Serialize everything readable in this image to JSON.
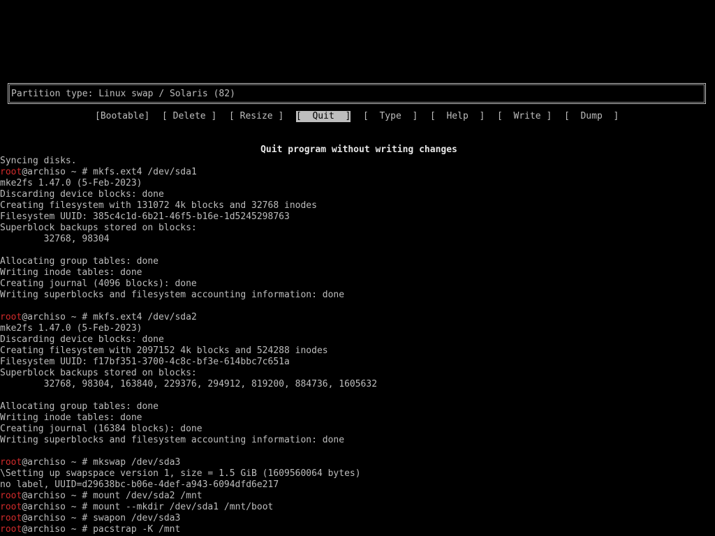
{
  "cfdisk": {
    "partition_type": "Partition type: Linux swap / Solaris (82)",
    "menu": [
      {
        "label": "[Bootable]",
        "selected": false
      },
      {
        "label": "[ Delete ]",
        "selected": false
      },
      {
        "label": "[ Resize ]",
        "selected": false
      },
      {
        "label": "[  Quit  ]",
        "selected": true
      },
      {
        "label": "[  Type  ]",
        "selected": false
      },
      {
        "label": "[  Help  ]",
        "selected": false
      },
      {
        "label": "[  Write ]",
        "selected": false
      },
      {
        "label": "[  Dump  ]",
        "selected": false
      }
    ],
    "hint": "Quit program without writing changes"
  },
  "terminal": {
    "colors": {
      "background": "#000000",
      "foreground": "#bdbdbd",
      "prompt_user": "#d22b2b"
    },
    "lines": [
      {
        "text": "Syncing disks."
      },
      {
        "prompt": {
          "user": "root",
          "host": "@archiso",
          "cmd": " ~ # mkfs.ext4 /dev/sda1"
        }
      },
      {
        "text": "mke2fs 1.47.0 (5-Feb-2023)"
      },
      {
        "text": "Discarding device blocks: done"
      },
      {
        "text": "Creating filesystem with 131072 4k blocks and 32768 inodes"
      },
      {
        "text": "Filesystem UUID: 385c4c1d-6b21-46f5-b16e-1d5245298763"
      },
      {
        "text": "Superblock backups stored on blocks:"
      },
      {
        "text": "        32768, 98304"
      },
      {
        "text": ""
      },
      {
        "text": "Allocating group tables: done"
      },
      {
        "text": "Writing inode tables: done"
      },
      {
        "text": "Creating journal (4096 blocks): done"
      },
      {
        "text": "Writing superblocks and filesystem accounting information: done"
      },
      {
        "text": ""
      },
      {
        "prompt": {
          "user": "root",
          "host": "@archiso",
          "cmd": " ~ # mkfs.ext4 /dev/sda2"
        }
      },
      {
        "text": "mke2fs 1.47.0 (5-Feb-2023)"
      },
      {
        "text": "Discarding device blocks: done"
      },
      {
        "text": "Creating filesystem with 2097152 4k blocks and 524288 inodes"
      },
      {
        "text": "Filesystem UUID: f17bf351-3700-4c8c-bf3e-614bbc7c651a"
      },
      {
        "text": "Superblock backups stored on blocks:"
      },
      {
        "text": "        32768, 98304, 163840, 229376, 294912, 819200, 884736, 1605632"
      },
      {
        "text": ""
      },
      {
        "text": "Allocating group tables: done"
      },
      {
        "text": "Writing inode tables: done"
      },
      {
        "text": "Creating journal (16384 blocks): done"
      },
      {
        "text": "Writing superblocks and filesystem accounting information: done"
      },
      {
        "text": ""
      },
      {
        "prompt": {
          "user": "root",
          "host": "@archiso",
          "cmd": " ~ # mkswap /dev/sda3"
        }
      },
      {
        "text": "\\Setting up swapspace version 1, size = 1.5 GiB (1609560064 bytes)"
      },
      {
        "text": "no label, UUID=d29638bc-b06e-4def-a943-6094dfd6e217"
      },
      {
        "prompt": {
          "user": "root",
          "host": "@archiso",
          "cmd": " ~ # mount /dev/sda2 /mnt"
        }
      },
      {
        "prompt": {
          "user": "root",
          "host": "@archiso",
          "cmd": " ~ # mount --mkdir /dev/sda1 /mnt/boot"
        }
      },
      {
        "prompt": {
          "user": "root",
          "host": "@archiso",
          "cmd": " ~ # swapon /dev/sda3"
        }
      },
      {
        "prompt": {
          "user": "root",
          "host": "@archiso",
          "cmd": " ~ # pacstrap -K /mnt"
        }
      }
    ]
  }
}
